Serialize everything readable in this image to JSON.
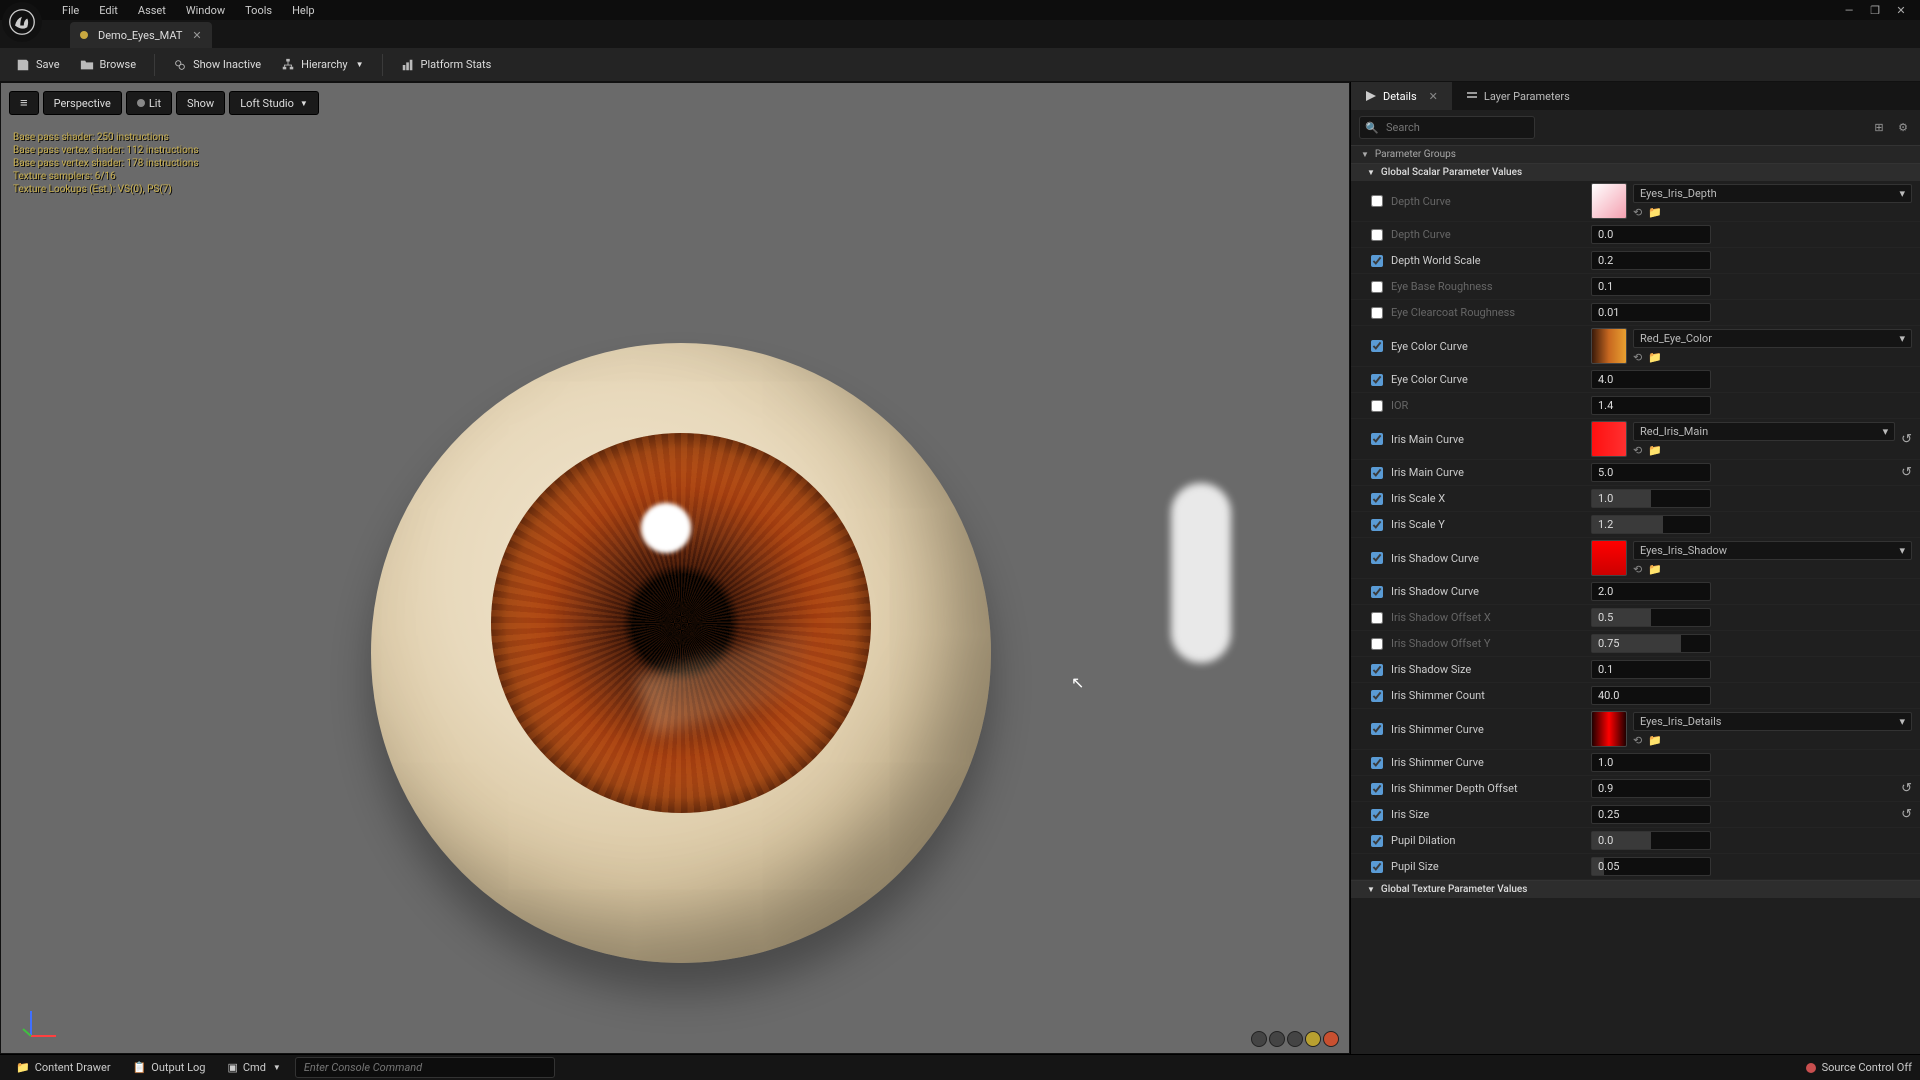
{
  "menu": {
    "file": "File",
    "edit": "Edit",
    "asset": "Asset",
    "window": "Window",
    "tools": "Tools",
    "help": "Help"
  },
  "tab": {
    "title": "Demo_Eyes_MAT"
  },
  "toolbar": {
    "save": "Save",
    "browse": "Browse",
    "show_inactive": "Show Inactive",
    "hierarchy": "Hierarchy",
    "platform_stats": "Platform Stats"
  },
  "viewport": {
    "perspective": "Perspective",
    "lit": "Lit",
    "show": "Show",
    "loft": "Loft Studio"
  },
  "stats": {
    "l1": "Base pass shader: 250 instructions",
    "l2": "Base pass vertex shader: 112 instructions",
    "l3": "Base pass vertex shader: 178 instructions",
    "l4": "Texture samplers: 6/16",
    "l5": "Texture Lookups (Est.): VS(0), PS(7)"
  },
  "panel": {
    "details": "Details",
    "layer_params": "Layer Parameters",
    "search_placeholder": "Search",
    "groups": "Parameter Groups",
    "global_scalar": "Global Scalar Parameter Values",
    "global_texture": "Global Texture Parameter Values"
  },
  "params": {
    "depth_curve": "Depth Curve",
    "depth_curve2": "Depth Curve",
    "depth_world_scale": "Depth World Scale",
    "eye_base_roughness": "Eye Base Roughness",
    "eye_clearcoat_roughness": "Eye Clearcoat Roughness",
    "eye_color_curve": "Eye Color Curve",
    "eye_color_curve2": "Eye Color Curve",
    "ior": "IOR",
    "iris_main_curve": "Iris Main Curve",
    "iris_main_curve2": "Iris Main Curve",
    "iris_scale_x": "Iris Scale X",
    "iris_scale_y": "Iris Scale Y",
    "iris_shadow_curve": "Iris Shadow Curve",
    "iris_shadow_curve2": "Iris Shadow Curve",
    "iris_shadow_offset_x": "Iris Shadow Offset X",
    "iris_shadow_offset_y": "Iris Shadow Offset Y",
    "iris_shadow_size": "Iris Shadow Size",
    "iris_shimmer_count": "Iris Shimmer Count",
    "iris_shimmer_curve": "Iris Shimmer Curve",
    "iris_shimmer_curve2": "Iris Shimmer Curve",
    "iris_shimmer_depth_offset": "Iris Shimmer Depth Offset",
    "iris_size": "Iris Size",
    "pupil_dilation": "Pupil Dilation",
    "pupil_size": "Pupil Size"
  },
  "vals": {
    "depth_curve2": "0.0",
    "depth_world_scale": "0.2",
    "eye_base_roughness": "0.1",
    "eye_clearcoat_roughness": "0.01",
    "eye_color_curve2": "4.0",
    "ior": "1.4",
    "iris_main_curve2": "5.0",
    "iris_scale_x": "1.0",
    "iris_scale_y": "1.2",
    "iris_shadow_curve2": "2.0",
    "iris_shadow_offset_x": "0.5",
    "iris_shadow_offset_y": "0.75",
    "iris_shadow_size": "0.1",
    "iris_shimmer_count": "40.0",
    "iris_shimmer_curve2": "1.0",
    "iris_shimmer_depth_offset": "0.9",
    "iris_size": "0.25",
    "pupil_dilation": "0.0",
    "pupil_size": "0.05"
  },
  "assets": {
    "depth": "Eyes_Iris_Depth",
    "eye_color": "Red_Eye_Color",
    "iris_main": "Red_Iris_Main",
    "iris_shadow": "Eyes_Iris_Shadow",
    "iris_details": "Eyes_Iris_Details"
  },
  "swatches": {
    "depth": "linear-gradient(135deg,#fff,#f4a0b0)",
    "eye_color": "linear-gradient(90deg,#3a1a0a,#c86820,#e8a030)",
    "iris_main": "linear-gradient(90deg,#ff1010,#ff3030)",
    "iris_shadow": "linear-gradient(180deg,#ff0000,#cc0000)",
    "iris_details": "linear-gradient(90deg,#200000,#ff0000,#200000)"
  },
  "bottom": {
    "content_drawer": "Content Drawer",
    "output_log": "Output Log",
    "cmd": "Cmd",
    "console_placeholder": "Enter Console Command",
    "source_control": "Source Control Off"
  }
}
